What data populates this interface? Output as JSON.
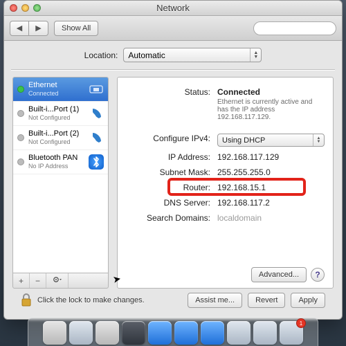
{
  "window": {
    "title": "Network"
  },
  "toolbar": {
    "show_all": "Show All",
    "search_placeholder": ""
  },
  "location": {
    "label": "Location:",
    "value": "Automatic"
  },
  "sidebar": {
    "items": [
      {
        "name": "Ethernet",
        "sub": "Connected",
        "status": "on",
        "icon": "ethernet"
      },
      {
        "name": "Built-i...Port (1)",
        "sub": "Not Configured",
        "status": "off",
        "icon": "phone"
      },
      {
        "name": "Built-i...Port (2)",
        "sub": "Not Configured",
        "status": "off",
        "icon": "phone"
      },
      {
        "name": "Bluetooth PAN",
        "sub": "No IP Address",
        "status": "off",
        "icon": "bluetooth"
      }
    ],
    "footer": {
      "add": "+",
      "remove": "−",
      "gear": "✻▾"
    }
  },
  "details": {
    "status_label": "Status:",
    "status_value": "Connected",
    "status_desc": "Ethernet is currently active and has the IP address 192.168.117.129.",
    "configure_label": "Configure IPv4:",
    "configure_value": "Using DHCP",
    "ip_label": "IP Address:",
    "ip_value": "192.168.117.129",
    "subnet_label": "Subnet Mask:",
    "subnet_value": "255.255.255.0",
    "router_label": "Router:",
    "router_value": "192.168.15.1",
    "dns_label": "DNS Server:",
    "dns_value": "192.168.117.2",
    "search_label": "Search Domains:",
    "search_value": "localdomain",
    "advanced": "Advanced...",
    "help": "?"
  },
  "footer": {
    "lock_text": "Click the lock to make changes.",
    "assist": "Assist me...",
    "revert": "Revert",
    "apply": "Apply"
  },
  "dock": {
    "badge": "1"
  }
}
